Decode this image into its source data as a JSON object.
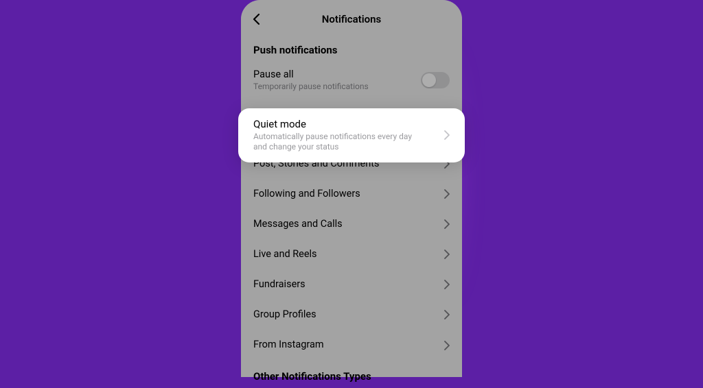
{
  "header": {
    "title": "Notifications"
  },
  "sections": {
    "push_title": "Push notifications",
    "other_title": "Other Notifications Types"
  },
  "pause_all": {
    "title": "Pause all",
    "subtitle": "Temporarily pause notifications"
  },
  "quiet_mode": {
    "title": "Quiet mode",
    "subtitle": "Automatically pause notifications every day and change your status"
  },
  "items": [
    {
      "label": "Post, Stories and Comments"
    },
    {
      "label": "Following and Followers"
    },
    {
      "label": "Messages and Calls"
    },
    {
      "label": "Live and Reels"
    },
    {
      "label": "Fundraisers"
    },
    {
      "label": "Group Profiles"
    },
    {
      "label": "From Instagram"
    }
  ]
}
